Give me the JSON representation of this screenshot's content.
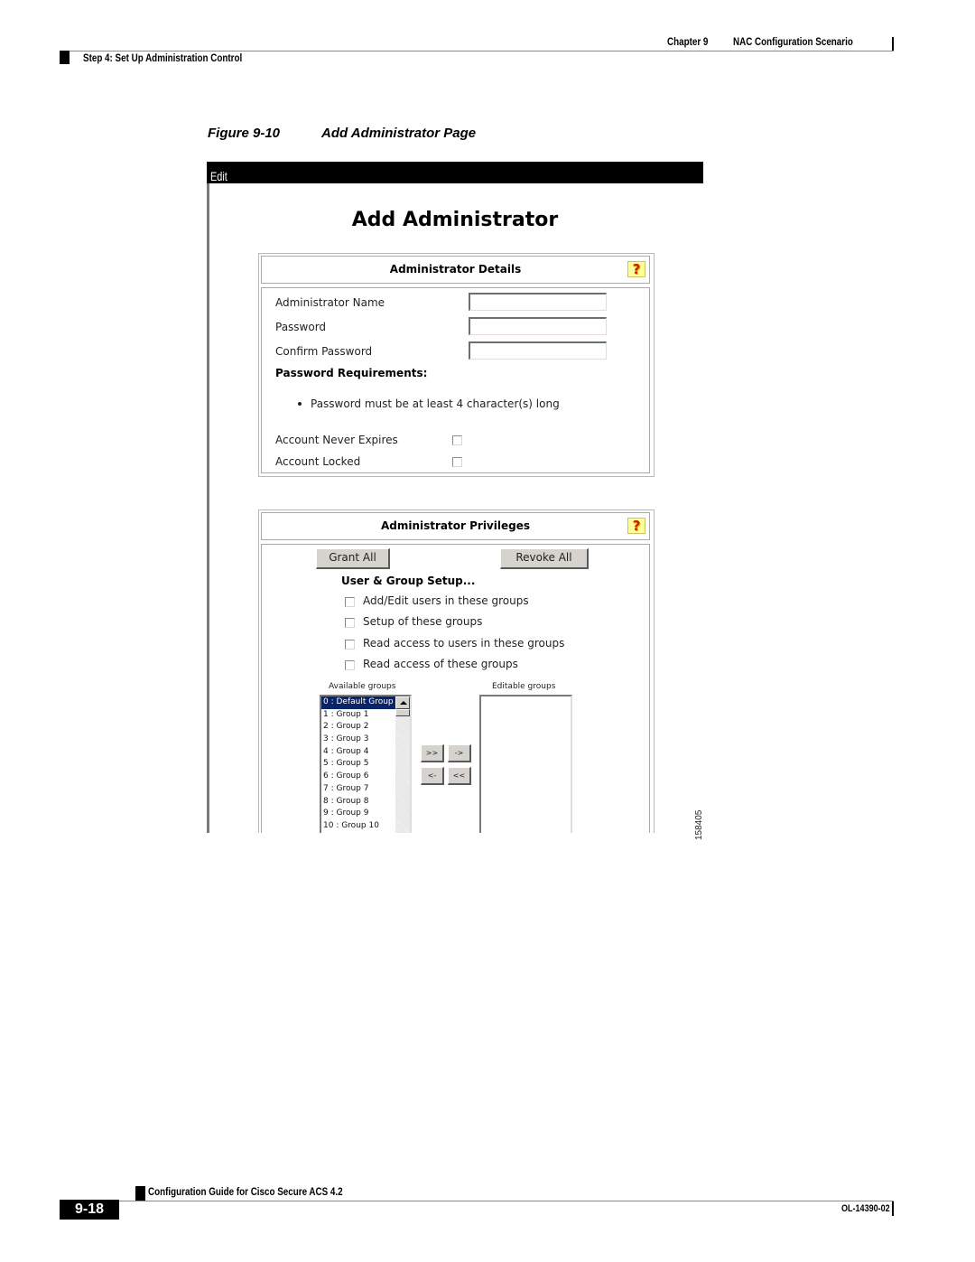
{
  "header": {
    "chapter_label": "Chapter 9",
    "chapter_title": "NAC Configuration Scenario",
    "section": "Step 4: Set Up Administration Control"
  },
  "figure": {
    "number": "Figure 9-10",
    "title": "Add Administrator Page",
    "id": "158405"
  },
  "app": {
    "edit_bar": "Edit",
    "page_title": "Add Administrator",
    "details": {
      "heading": "Administrator Details",
      "help_icon": "?",
      "fields": [
        {
          "label": "Administrator Name",
          "value": ""
        },
        {
          "label": "Password",
          "value": ""
        },
        {
          "label": "Confirm Password",
          "value": ""
        }
      ],
      "requirements_heading": "Password Requirements:",
      "requirement": "Password must be at least 4 character(s) long",
      "checkboxes": [
        {
          "label": "Account Never Expires",
          "checked": false
        },
        {
          "label": "Account Locked",
          "checked": false
        }
      ]
    },
    "privileges": {
      "heading": "Administrator Privileges",
      "help_icon": "?",
      "grant_all": "Grant All",
      "revoke_all": "Revoke All",
      "setup_heading": "User & Group Setup...",
      "options": [
        {
          "label": "Add/Edit users in these groups",
          "checked": false
        },
        {
          "label": "Setup of these groups",
          "checked": false
        },
        {
          "label": "Read access to users in these groups",
          "checked": false
        },
        {
          "label": "Read access of these groups",
          "checked": false
        }
      ],
      "available_label": "Available groups",
      "editable_label": "Editable groups",
      "available_groups": [
        "0 : Default Group",
        "1 : Group 1",
        "2 : Group 2",
        "3 : Group 3",
        "4 : Group 4",
        "5 : Group 5",
        "6 : Group 6",
        "7 : Group 7",
        "8 : Group 8",
        "9 : Group 9",
        "10 : Group 10"
      ],
      "selected_group": "0 : Default Group",
      "editable_groups": [],
      "move_buttons": {
        "add_all": ">>",
        "add": "->",
        "remove": "<-",
        "remove_all": "<<"
      }
    }
  },
  "footer": {
    "guide_title": "Configuration Guide for Cisco Secure ACS 4.2",
    "page_number": "9-18",
    "doc_number": "OL-14390-02"
  }
}
